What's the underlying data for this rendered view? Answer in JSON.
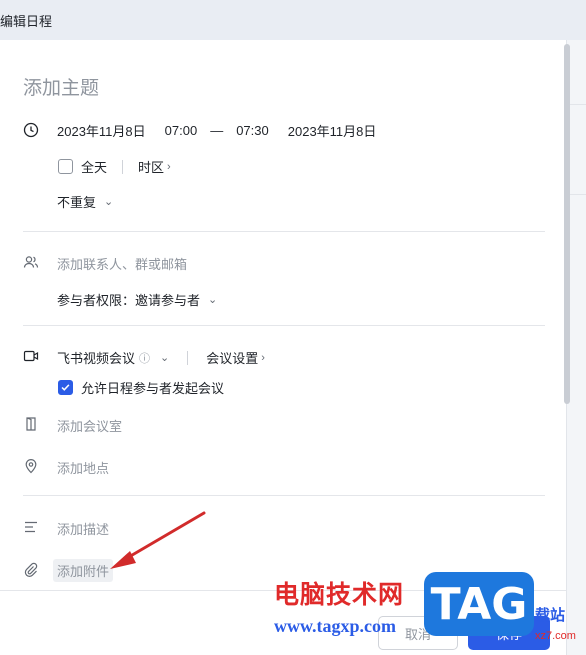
{
  "window": {
    "title": "编辑日程"
  },
  "form": {
    "subject_placeholder": "添加主题",
    "time": {
      "start_date": "2023年11月8日",
      "start_time": "07:00",
      "dash": "—",
      "end_time": "07:30",
      "end_date": "2023年11月8日"
    },
    "all_day_label": "全天",
    "timezone_label": "时区",
    "repeat_label": "不重复",
    "attendees_placeholder": "添加联系人、群或邮箱",
    "permission_label": "参与者权限：",
    "permission_value": "邀请参与者",
    "video_meeting_label": "飞书视频会议",
    "meeting_settings_label": "会议设置",
    "allow_start_label": "允许日程参与者发起会议",
    "allow_start_checked": true,
    "room_placeholder": "添加会议室",
    "location_placeholder": "添加地点",
    "description_placeholder": "添加描述",
    "attachment_label": "添加附件"
  },
  "footer": {
    "cancel_label": "取消",
    "save_label": "保存"
  },
  "watermark": {
    "site_name": "电脑技术网",
    "url": "www.tagxp.com",
    "badge": "TAG",
    "side_text": "载站",
    "side_small": "xz7.com"
  },
  "colors": {
    "accent": "#2b5ce6",
    "arrow": "#d12b2b"
  }
}
